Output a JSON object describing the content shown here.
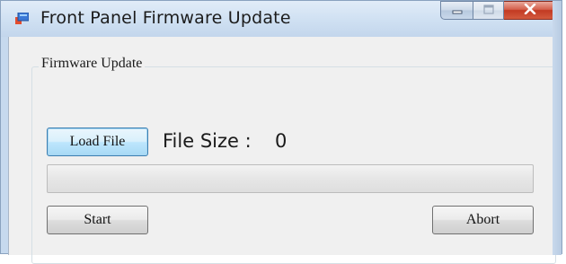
{
  "window": {
    "title": "Front Panel Firmware Update",
    "icon": "app-window-icon",
    "caption_buttons": {
      "minimize_icon": "minimize-icon",
      "maximize_icon": "maximize-icon",
      "close_icon": "close-icon",
      "close_label": "X"
    }
  },
  "group": {
    "label": "Firmware Update"
  },
  "controls": {
    "load_file_label": "Load File",
    "file_size_label": "File Size :",
    "file_size_value": "0",
    "progress_percent": 0,
    "start_label": "Start",
    "abort_label": "Abort"
  },
  "colors": {
    "close_button": "#c23a22",
    "focused_button_border": "#3c7fb1",
    "titlebar": "#cfe0f2"
  }
}
